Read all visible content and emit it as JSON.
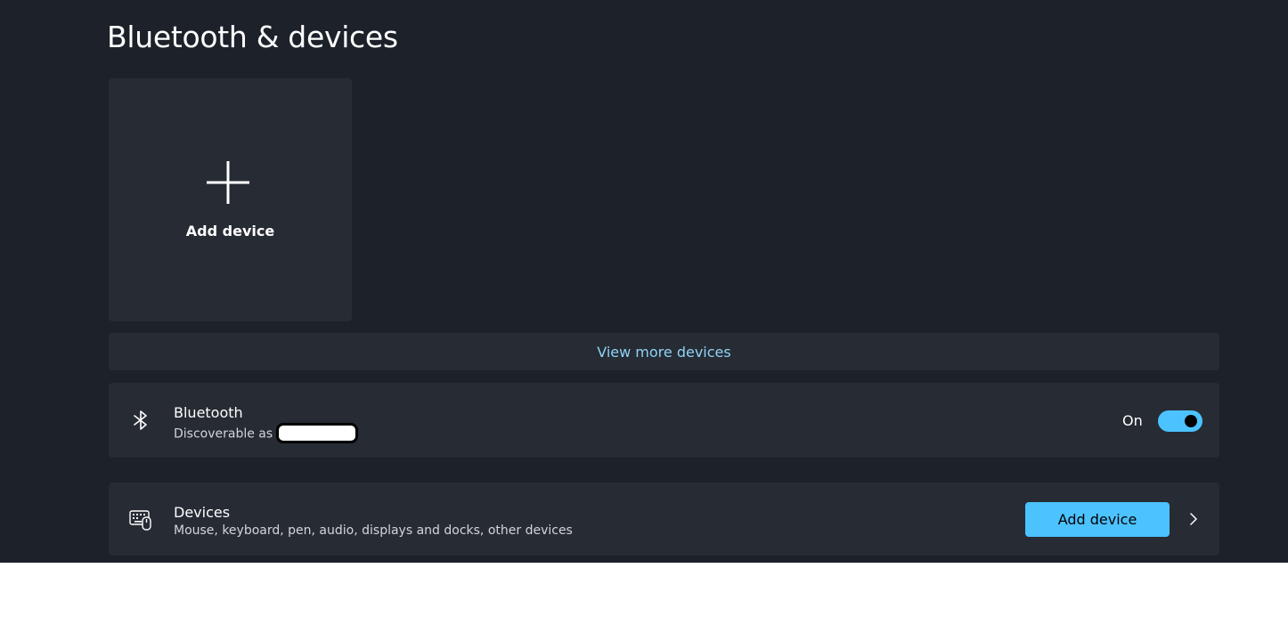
{
  "page": {
    "title": "Bluetooth & devices"
  },
  "add_tile": {
    "label": "Add device",
    "icon": "plus-icon"
  },
  "view_more": {
    "label": "View more devices"
  },
  "bluetooth": {
    "icon": "bluetooth-icon",
    "title": "Bluetooth",
    "subtitle": "Discoverable as",
    "state_label": "On",
    "toggle_on": true
  },
  "devices": {
    "icon": "keyboard-mouse-icon",
    "title": "Devices",
    "subtitle": "Mouse, keyboard, pen, audio, displays and docks, other devices",
    "button_label": "Add device",
    "chevron_icon": "chevron-right-icon"
  },
  "colors": {
    "background": "#1c212a",
    "card": "#262b34",
    "accent": "#4cc2ff",
    "link": "#8fd3f3"
  }
}
